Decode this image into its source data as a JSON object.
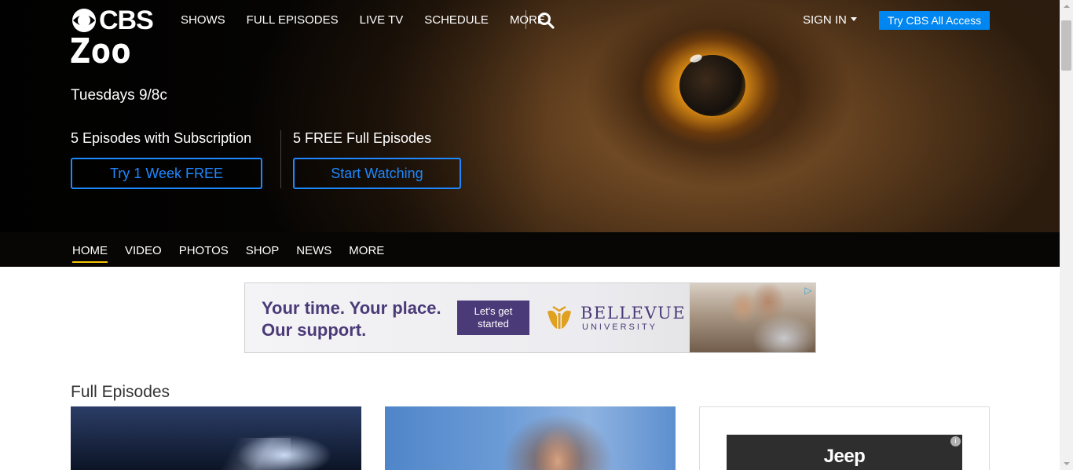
{
  "nav": {
    "logo_text": "CBS",
    "links": [
      "SHOWS",
      "FULL EPISODES",
      "LIVE TV",
      "SCHEDULE",
      "MORE"
    ],
    "signin": "SIGN IN",
    "cta": "Try CBS All Access"
  },
  "hero": {
    "title": "Zoo",
    "airtime": "Tuesdays 9/8c",
    "subscription_label": "5 Episodes with Subscription",
    "subscription_button": "Try 1 Week FREE",
    "free_label": "5 FREE Full Episodes",
    "free_button": "Start Watching"
  },
  "subnav": {
    "items": [
      "HOME",
      "VIDEO",
      "PHOTOS",
      "SHOP",
      "NEWS",
      "MORE"
    ],
    "active": "HOME"
  },
  "ad": {
    "headline_1": "Your time. Your place.",
    "headline_2": "Our support.",
    "cta_1": "Let's get",
    "cta_2": "started",
    "brand": "BELLEVUE",
    "brand_sub": "UNIVERSITY",
    "brand_color": "#4b3a78"
  },
  "main": {
    "section_title": "Full Episodes"
  },
  "side_ad": {
    "brand": "Jeep"
  },
  "colors": {
    "accent_blue": "#0086f0",
    "button_outline": "#1e88ff",
    "subnav_active": "#f5c400"
  }
}
